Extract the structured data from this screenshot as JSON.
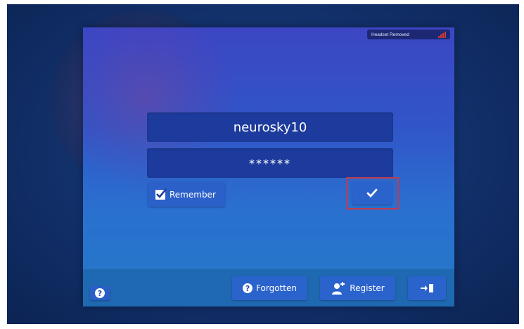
{
  "headset": {
    "status": "Headset Removed"
  },
  "login": {
    "username": "neurosky10",
    "password": "******",
    "remember_label": "Remember",
    "remember_checked": true
  },
  "footer": {
    "forgotten_label": "Forgotten",
    "register_label": "Register"
  },
  "colors": {
    "panel_top": "#3c46c4",
    "panel_bottom": "#2379c8",
    "field": "#1d3b9c",
    "button": "#2b63cc",
    "highlight": "#c23b4c",
    "signal": "#d23a3a"
  },
  "icons": {
    "help": "question-circle-icon",
    "submit": "checkmark-icon",
    "forgotten": "question-circle-icon",
    "register": "add-user-icon",
    "exit": "exit-door-icon",
    "signal": "signal-bars-icon"
  }
}
